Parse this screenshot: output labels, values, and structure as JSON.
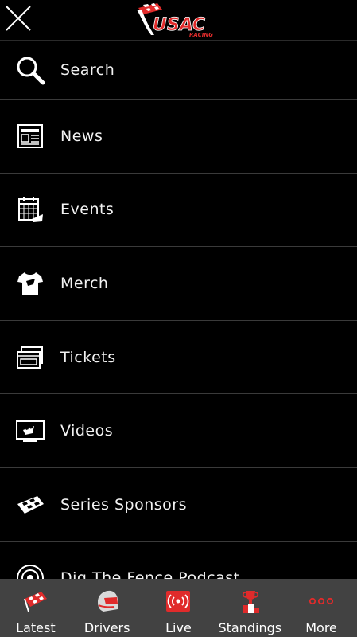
{
  "header": {
    "logo_text": "USAC",
    "logo_subtext": "RACING"
  },
  "menu": {
    "items": [
      {
        "label": "Search",
        "icon": "search-icon"
      },
      {
        "label": "News",
        "icon": "newspaper-icon"
      },
      {
        "label": "Events",
        "icon": "calendar-icon"
      },
      {
        "label": "Merch",
        "icon": "tshirt-icon"
      },
      {
        "label": "Tickets",
        "icon": "tickets-icon"
      },
      {
        "label": "Videos",
        "icon": "tv-icon"
      },
      {
        "label": "Series Sponsors",
        "icon": "flag-icon"
      },
      {
        "label": "Dig The Fence Podcast",
        "icon": "podcast-icon"
      }
    ]
  },
  "tabbar": {
    "tabs": [
      {
        "label": "Latest",
        "icon": "checkered-flag-icon"
      },
      {
        "label": "Drivers",
        "icon": "helmet-icon"
      },
      {
        "label": "Live",
        "icon": "live-radio-icon"
      },
      {
        "label": "Standings",
        "icon": "trophy-icon"
      },
      {
        "label": "More",
        "icon": "more-dots-icon"
      }
    ]
  },
  "colors": {
    "accent_red": "#e02b2b",
    "background": "#000000",
    "tabbar_bg": "#424242",
    "divider": "#3a3a3a"
  }
}
